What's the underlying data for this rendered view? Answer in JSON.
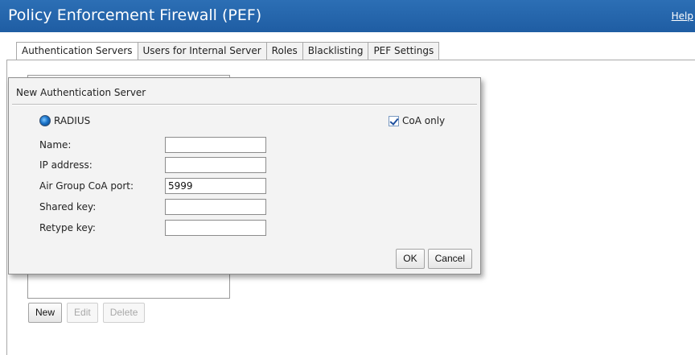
{
  "window": {
    "title": "Policy Enforcement Firewall (PEF)",
    "help_link": "Help"
  },
  "tabs": [
    {
      "label": "Authentication Servers",
      "active": true
    },
    {
      "label": "Users for Internal Server",
      "active": false
    },
    {
      "label": "Roles",
      "active": false
    },
    {
      "label": "Blacklisting",
      "active": false
    },
    {
      "label": "PEF Settings",
      "active": false
    }
  ],
  "server_list": {
    "items": [],
    "buttons": {
      "new": "New",
      "edit": "Edit",
      "delete": "Delete"
    }
  },
  "dialog": {
    "title": "New Authentication Server",
    "radio": {
      "label": "RADIUS",
      "selected": true
    },
    "coa_only": {
      "label": "CoA only",
      "checked": true
    },
    "fields": {
      "name": {
        "label": "Name:",
        "value": ""
      },
      "ip_address": {
        "label": "IP address:",
        "value": ""
      },
      "coa_port": {
        "label": "Air Group CoA port:",
        "value": "5999"
      },
      "shared_key": {
        "label": "Shared key:",
        "value": ""
      },
      "retype_key": {
        "label": "Retype key:",
        "value": ""
      }
    },
    "buttons": {
      "ok": "OK",
      "cancel": "Cancel"
    }
  },
  "colors": {
    "titlebar": "#1f5da3",
    "title_text": "#ffffff",
    "dialog_bg": "#f3f3f3"
  }
}
